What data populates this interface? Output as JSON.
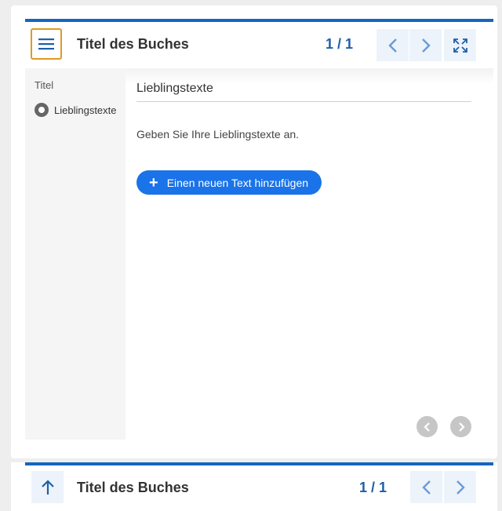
{
  "top_panel": {
    "title": "Titel des Buches",
    "page_counter": "1 / 1",
    "icons": {
      "menu": "hamburger-menu-icon",
      "prev": "chevron-left-icon",
      "next": "chevron-right-icon",
      "fullscreen": "expand-icon"
    }
  },
  "sidebar": {
    "title": "Titel",
    "items": [
      {
        "label": "Lieblingstexte",
        "icon": "radio-selected-icon"
      }
    ]
  },
  "content": {
    "heading": "Lieblingstexte",
    "description": "Geben Sie Ihre Lieblingstexte an.",
    "add_button_label": "Einen neuen Text hinzufügen",
    "add_button_icon": "+"
  },
  "bottom_panel": {
    "title": "Titel des Buches",
    "page_counter": "1 / 1",
    "icons": {
      "up": "arrow-up-icon",
      "prev": "chevron-left-icon",
      "next": "chevron-right-icon"
    }
  },
  "colors": {
    "brand_blue": "#1565c0",
    "accent_orange": "#e09a22",
    "button_blue": "#1a73e8",
    "nav_button_bg": "#edf3fb",
    "counter_blue": "#1f5fa8"
  }
}
